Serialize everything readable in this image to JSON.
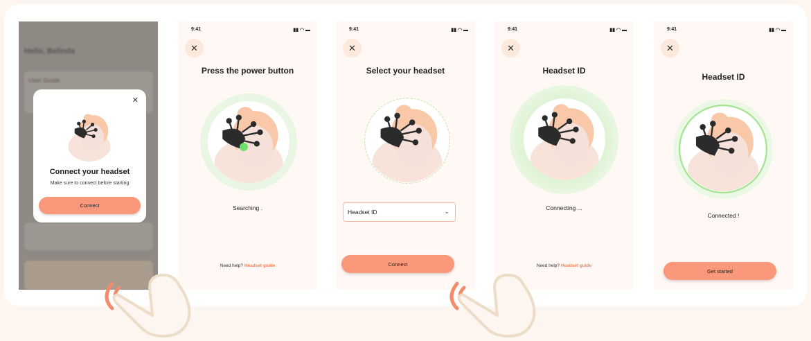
{
  "colors": {
    "accent": "#f9987a",
    "link": "#f0845c",
    "pale_green": "#e3f4dc",
    "green": "#9fe38c"
  },
  "screens": [
    {
      "blurred_title": "Hello, Belinda",
      "blurred_section": "User Guide",
      "modal": {
        "title": "Connect your headset",
        "subtitle": "Make sure to connect before starting",
        "button": "Connect",
        "close_icon": "close-icon"
      }
    },
    {
      "time": "9:41",
      "title": "Press the power button",
      "status": "Searching .",
      "help_text": "Need help?",
      "help_link": "Headset guide"
    },
    {
      "time": "9:41",
      "title": "Select your headset",
      "select_value": "Headset ID",
      "button": "Connect"
    },
    {
      "time": "9:41",
      "title": "Headset ID",
      "status": "Connecting ...",
      "help_text": "Need help?",
      "help_link": "Headset guide"
    },
    {
      "time": "9:41",
      "title": "Headset ID",
      "status": "Connected !",
      "button": "Get started"
    }
  ]
}
